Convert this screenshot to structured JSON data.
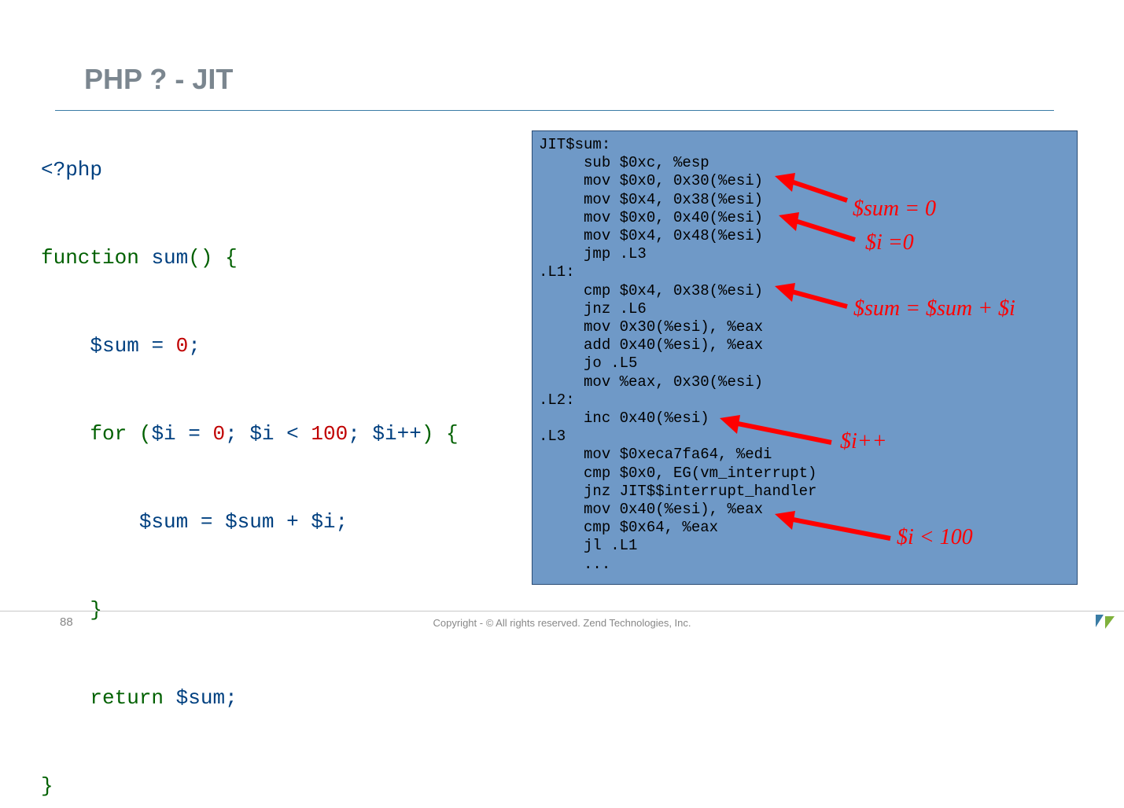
{
  "title": "PHP ? - JIT",
  "php": {
    "open": "<?php",
    "func_kw": "function",
    "func_name": "sum",
    "sum_var": "$sum",
    "eq": "=",
    "zero": "0",
    "for_kw": "for",
    "i_var": "$i",
    "lt": "<",
    "hundred": "100",
    "ipp": "$i++",
    "plus": "+",
    "return_kw": "return",
    "lbrace": "{",
    "rbrace": "}",
    "semi": ";",
    "lparen": "(",
    "rparen": ")"
  },
  "asm": "JIT$sum:\n     sub $0xc, %esp\n     mov $0x0, 0x30(%esi)\n     mov $0x4, 0x38(%esi)\n     mov $0x0, 0x40(%esi)\n     mov $0x4, 0x48(%esi)\n     jmp .L3\n.L1:\n     cmp $0x4, 0x38(%esi)\n     jnz .L6\n     mov 0x30(%esi), %eax\n     add 0x40(%esi), %eax\n     jo .L5\n     mov %eax, 0x30(%esi)\n.L2:\n     inc 0x40(%esi)\n.L3\n     mov $0xeca7fa64, %edi\n     cmp $0x0, EG(vm_interrupt)\n     jnz JIT$$interrupt_handler\n     mov 0x40(%esi), %eax\n     cmp $0x64, %eax\n     jl .L1\n     ...",
  "annotations": {
    "sum0": "$sum = 0",
    "i0": "$i =0",
    "sumplus": "$sum = $sum + $i",
    "ipp": "$i++",
    "ilt": "$i < 100"
  },
  "footer": {
    "page": "88",
    "copyright": "Copyright - © All rights reserved. Zend Technologies, Inc."
  }
}
